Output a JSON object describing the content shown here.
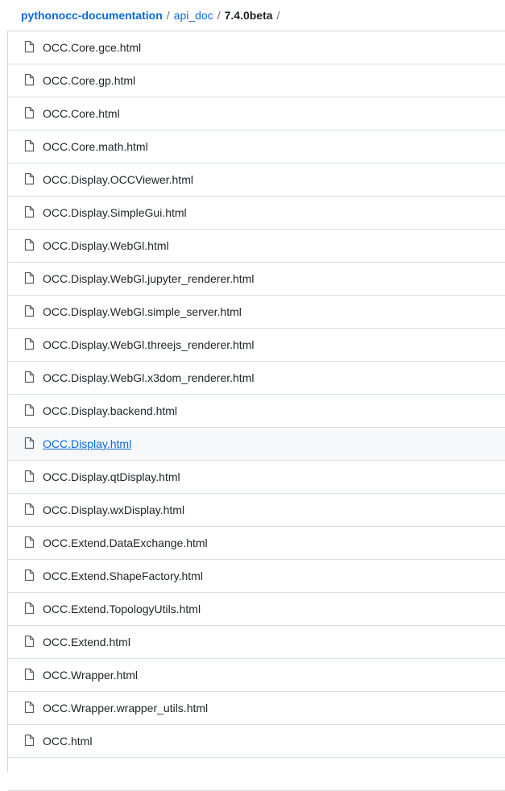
{
  "breadcrumb": {
    "repo": "pythonocc-documentation",
    "separator": "/",
    "folder": "api_doc",
    "current": "7.4.0beta"
  },
  "files": {
    "icon": "file-icon",
    "hover_index": 12,
    "items": [
      {
        "name": "OCC.Core.gce.html"
      },
      {
        "name": "OCC.Core.gp.html"
      },
      {
        "name": "OCC.Core.html"
      },
      {
        "name": "OCC.Core.math.html"
      },
      {
        "name": "OCC.Display.OCCViewer.html"
      },
      {
        "name": "OCC.Display.SimpleGui.html"
      },
      {
        "name": "OCC.Display.WebGl.html"
      },
      {
        "name": "OCC.Display.WebGl.jupyter_renderer.html"
      },
      {
        "name": "OCC.Display.WebGl.simple_server.html"
      },
      {
        "name": "OCC.Display.WebGl.threejs_renderer.html"
      },
      {
        "name": "OCC.Display.WebGl.x3dom_renderer.html"
      },
      {
        "name": "OCC.Display.backend.html"
      },
      {
        "name": "OCC.Display.html"
      },
      {
        "name": "OCC.Display.qtDisplay.html"
      },
      {
        "name": "OCC.Display.wxDisplay.html"
      },
      {
        "name": "OCC.Extend.DataExchange.html"
      },
      {
        "name": "OCC.Extend.ShapeFactory.html"
      },
      {
        "name": "OCC.Extend.TopologyUtils.html"
      },
      {
        "name": "OCC.Extend.html"
      },
      {
        "name": "OCC.Wrapper.html"
      },
      {
        "name": "OCC.Wrapper.wrapper_utils.html"
      },
      {
        "name": "OCC.html"
      },
      {
        "name": ""
      }
    ]
  }
}
